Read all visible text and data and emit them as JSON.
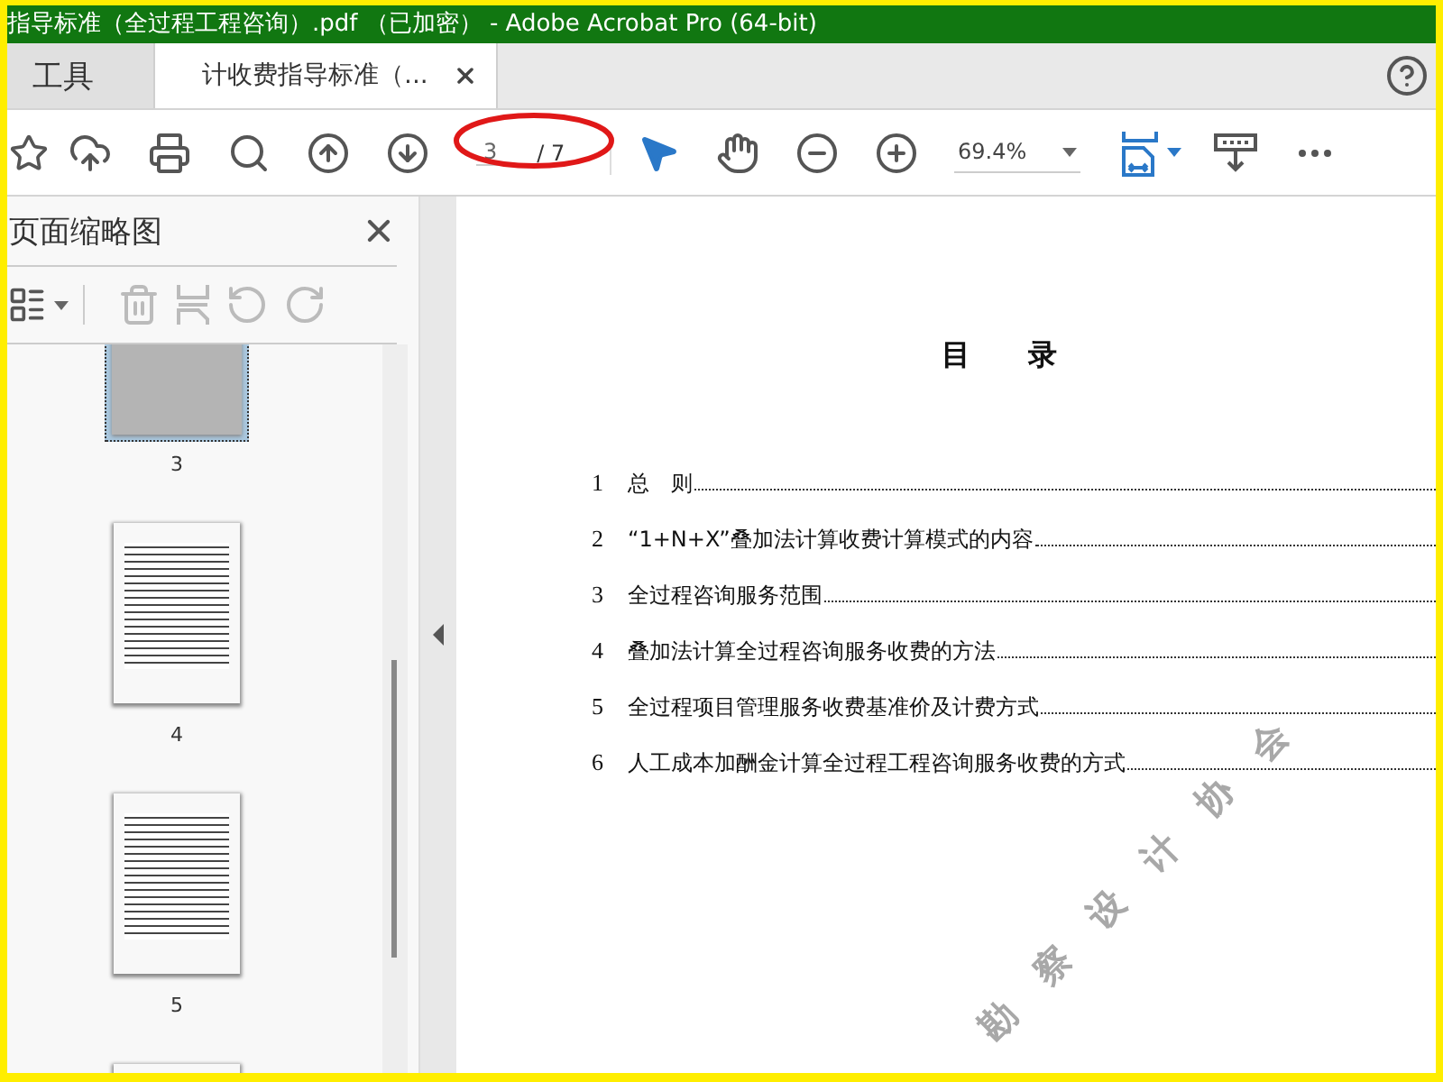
{
  "window": {
    "title": "指导标准（全过程工程咨询）.pdf （已加密） - Adobe Acrobat Pro (64-bit)"
  },
  "tabs": [
    {
      "label": "工具",
      "selected": false,
      "closable": false
    },
    {
      "label": "计收费指导标准（...",
      "selected": true,
      "closable": true
    }
  ],
  "toolbar": {
    "page_number": "3",
    "page_total": "/ 7",
    "zoom": "69.4%"
  },
  "sidebar": {
    "title": "页面缩略图",
    "thumbnails": [
      {
        "label": "3",
        "selected": true
      },
      {
        "label": "4",
        "selected": false
      },
      {
        "label": "5",
        "selected": false
      },
      {
        "selected": false
      }
    ]
  },
  "document": {
    "heading": "目　录",
    "watermark_characters": [
      "勘",
      "察",
      "设",
      "计",
      "协",
      "会"
    ],
    "toc": [
      {
        "number": "1",
        "title": "总　则"
      },
      {
        "number": "2",
        "title": "“1+N+X”叠加法计算收费计算模式的内容"
      },
      {
        "number": "3",
        "title": "全过程咨询服务范围"
      },
      {
        "number": "4",
        "title": "叠加法计算全过程咨询服务收费的方法"
      },
      {
        "number": "5",
        "title": "全过程项目管理服务收费基准价及计费方式"
      },
      {
        "number": "6",
        "title": "人工成本加酬金计算全过程工程咨询服务收费的方式"
      }
    ]
  }
}
